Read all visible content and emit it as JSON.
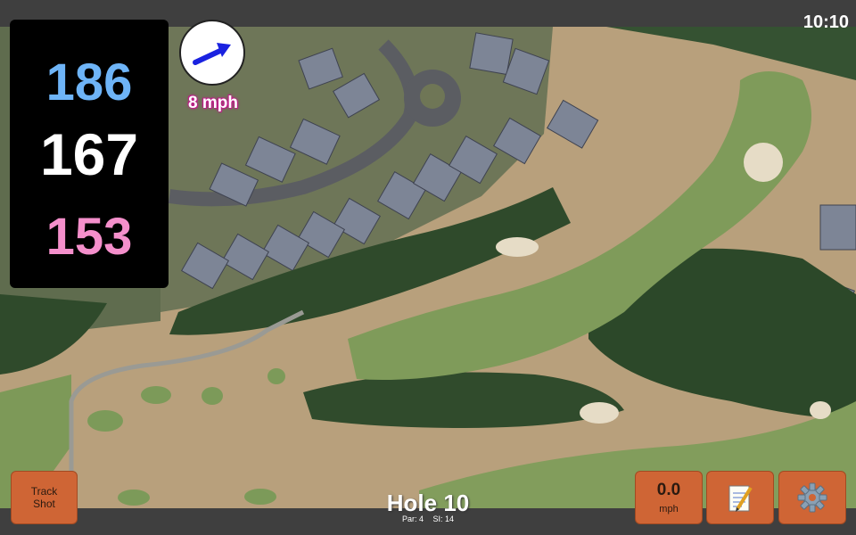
{
  "status_bar": {
    "time": "10:10"
  },
  "distances": {
    "back": "186",
    "middle": "167",
    "front": "153"
  },
  "wind": {
    "speed_label": "8 mph",
    "direction_icon": "arrow-up-right-icon"
  },
  "hole": {
    "title": "Hole 10",
    "par_label": "Par: 4",
    "si_label": "SI: 14"
  },
  "buttons": {
    "track_shot": "Track Shot",
    "speed_value": "0.0",
    "speed_unit": "mph",
    "notes_icon": "notepad-icon",
    "settings_icon": "gear-icon"
  },
  "colors": {
    "back_distance": "#6eb4f7",
    "middle_distance": "#ffffff",
    "front_distance": "#f48fcb",
    "button": "#cf6535"
  }
}
